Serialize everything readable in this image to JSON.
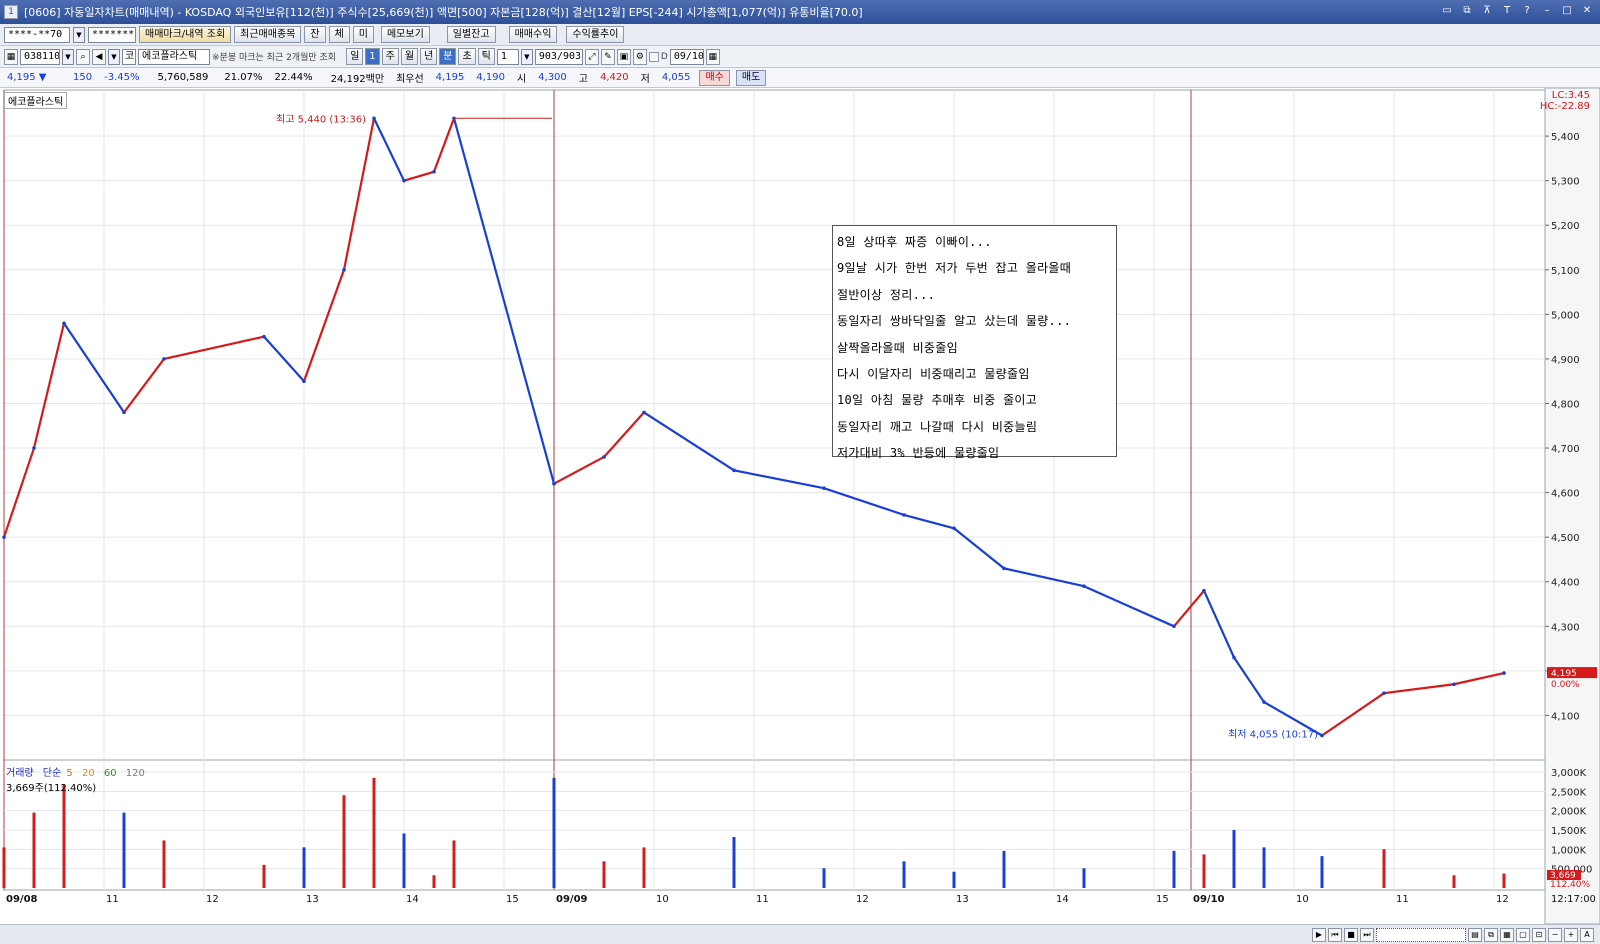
{
  "window": {
    "title": "[0606] 자동일자차트(매매내역) - KOSDAQ 외국인보유[112(천)] 주식수[25,669(천)] 액면[500] 자본금[128(억)] 결산[12월] EPS[-244] 시가총액[1,077(억)] 유통비율[70.0]",
    "app_icon": "1"
  },
  "toolbar1": {
    "account": "****-**70",
    "password": "********",
    "btn_marks": "매매마크/내역 조회",
    "btn_recent": "최근매매종목",
    "btn_jan": "잔",
    "btn_che": "체",
    "btn_mi": "미",
    "btn_memo": "메모보기",
    "btn_daily": "일별잔고",
    "btn_profit": "매매수익",
    "btn_rate": "수익률추이"
  },
  "toolbar2": {
    "code": "038110",
    "stock_badge": "코",
    "stock_name": "에코플라스틱",
    "note": "※분봉 마크는 최근 2개월만 조회",
    "period_day": "일",
    "period_num": "1",
    "period_week": "주",
    "period_month": "월",
    "period_year": "년",
    "period_min": "분",
    "period_sec": "초",
    "period_tick": "틱",
    "interval": "1",
    "count": "903/903",
    "date": "09/10",
    "check_d": "D"
  },
  "quote": {
    "price": "4,195 ▼",
    "change": "150",
    "change_pct": "-3.45%",
    "volume": "5,760,589",
    "pct1": "21.07%",
    "pct2": "22.44%",
    "amount": "24,192백만",
    "best_label": "최우선",
    "best_ask": "4,195",
    "best_bid": "4,190",
    "open_label": "시",
    "open": "4,300",
    "high_label": "고",
    "high": "4,420",
    "low_label": "저",
    "low": "4,055",
    "buy": "매수",
    "sell": "매도"
  },
  "chart": {
    "name": "에코플라스틱",
    "lc": "LC:3.45",
    "hc": "HC:-22.89",
    "high_label": "최고 5,440 (13:36)",
    "low_label": "최저 4,055 (10:17)",
    "price_ticks": [
      "5,400",
      "5,300",
      "5,200",
      "5,100",
      "5,000",
      "4,900",
      "4,800",
      "4,700",
      "4,600",
      "4,500",
      "4,400",
      "4,300",
      "4,200",
      "4,100"
    ],
    "current_price": "4,195",
    "current_pct": "0.00%",
    "volume_ticks": [
      "3,000K",
      "2,500K",
      "2,000K",
      "1,500K",
      "1,000K",
      "500,000"
    ],
    "current_volume": "3,669",
    "current_volume_pct": "112.40%",
    "x_labels": [
      "09/08",
      "11",
      "12",
      "13",
      "14",
      "15",
      "09/09",
      "10",
      "11",
      "12",
      "13",
      "14",
      "15",
      "09/10",
      "10",
      "11",
      "12"
    ],
    "time": "12:17:00",
    "volume_label": "거래량",
    "ma_label": "단순",
    "ma": [
      "5",
      "20",
      "60",
      "120"
    ],
    "vol_now": "3,669주(112.40%)"
  },
  "memo": {
    "lines": [
      "8일 상따후 짜증 이빠이...",
      "9일날 시가 한번 저가 두번 잡고 올라올때",
      "절반이상 정리...",
      "동일자리 쌍바닥일줄 알고 샀는데 물량...",
      "살짝올라올때 비중줄임",
      "다시 이달자리 비중때리고 물량줄임",
      "10일 아침 물량 추매후 비중 줄이고",
      "동일자리 깨고 나갈때 다시 비중늘림",
      "저가대비 3% 반등에 물량줄임"
    ]
  },
  "chart_data": {
    "type": "line",
    "title": "에코플라스틱",
    "ylabel": "",
    "xlabel": "",
    "ylim": [
      4000,
      5490
    ],
    "x": [
      "09/08 09:00",
      "09/08 09:30",
      "09/08 10:00",
      "09/08 11:00",
      "09/08 11:40",
      "09/08 12:30",
      "09/08 13:00",
      "09/08 13:20",
      "09/08 13:36",
      "09/08 14:00",
      "09/08 14:20",
      "09/08 14:30",
      "09/09 09:00",
      "09/09 09:30",
      "09/09 10:00",
      "09/09 11:00",
      "09/09 12:00",
      "09/09 13:00",
      "09/09 13:30",
      "09/09 14:00",
      "09/09 14:30",
      "09/09 15:00",
      "09/10 09:00",
      "09/10 09:20",
      "09/10 09:40",
      "09/10 10:17",
      "09/10 11:00",
      "09/10 12:00",
      "09/10 12:17"
    ],
    "series": [
      {
        "values": [
          4500,
          4700,
          4980,
          4780,
          4900,
          4950,
          4850,
          5100,
          5440,
          5300,
          5320,
          5440,
          4620,
          4680,
          4780,
          4650,
          4610,
          4550,
          4520,
          4430,
          4390,
          4300,
          4380,
          4230,
          4130,
          4055,
          4150,
          4170,
          4195
        ]
      }
    ],
    "volume_ylim": [
      0,
      3000000
    ],
    "grid": true
  }
}
